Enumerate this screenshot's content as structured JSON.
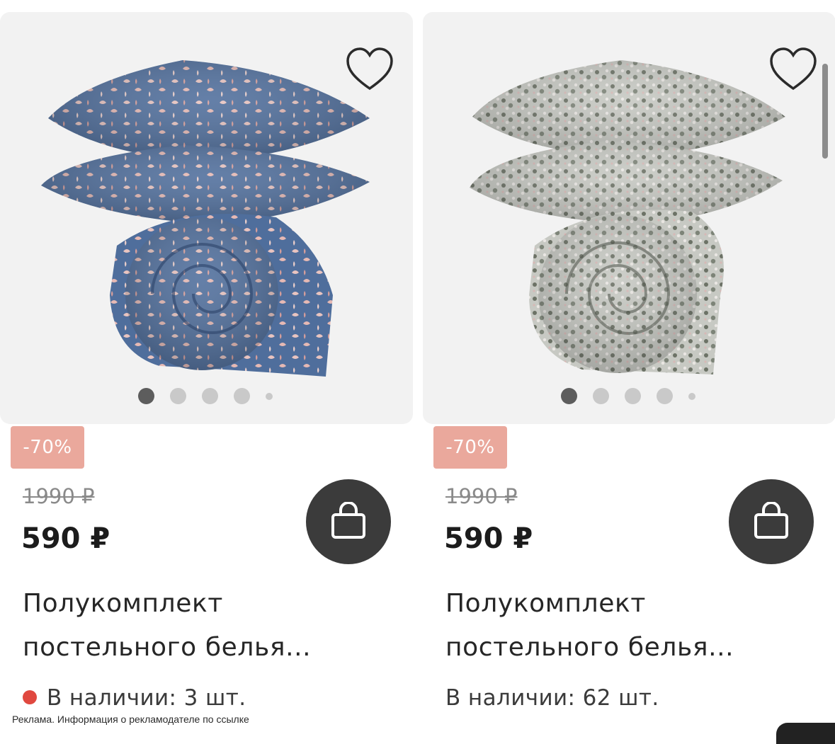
{
  "colors": {
    "badge_bg": "#eaa89c",
    "cart_button_bg": "#3b3b3b",
    "in_stock_low_dot": "#e0483f",
    "card_image_bg": "#f2f2f2"
  },
  "products": [
    {
      "discount": "-70%",
      "old_price": "1990 ₽",
      "price": "590 ₽",
      "title_line1": "Полукомплект",
      "title_line2": "постельного белья...",
      "stock": "В наличии: 3 шт.",
      "stock_low": true,
      "pattern": "blue-floral",
      "gallery_dots": 5,
      "gallery_active": 1,
      "favorite_icon": "heart-outline-icon",
      "cart_icon": "shopping-bag-icon"
    },
    {
      "discount": "-70%",
      "old_price": "1990 ₽",
      "price": "590 ₽",
      "title_line1": "Полукомплект",
      "title_line2": "постельного белья...",
      "stock": "В наличии: 62 шт.",
      "stock_low": false,
      "pattern": "grey-floral",
      "gallery_dots": 5,
      "gallery_active": 1,
      "favorite_icon": "heart-outline-icon",
      "cart_icon": "shopping-bag-icon"
    }
  ],
  "ad_notice": "Реклама. Информация о рекламодателе по ссылке"
}
